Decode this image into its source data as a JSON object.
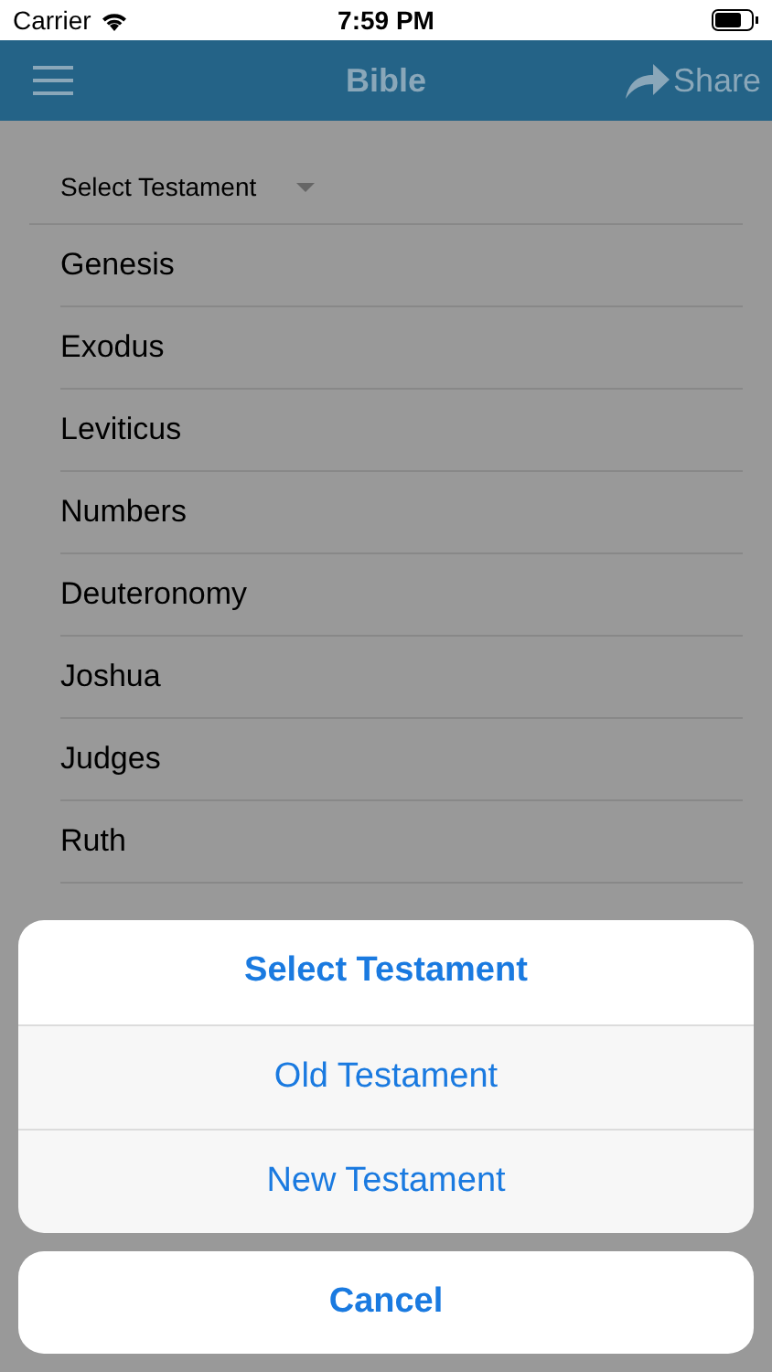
{
  "status_bar": {
    "carrier": "Carrier",
    "time": "7:59 PM"
  },
  "nav_bar": {
    "title": "Bible",
    "share": "Share"
  },
  "testament_dropdown": {
    "label": "Select Testament"
  },
  "books": [
    "Genesis",
    "Exodus",
    "Leviticus",
    "Numbers",
    "Deuteronomy",
    "Joshua",
    "Judges",
    "Ruth"
  ],
  "action_sheet": {
    "title": "Select Testament",
    "options": [
      "Old Testament",
      "New Testament"
    ],
    "cancel": "Cancel"
  }
}
